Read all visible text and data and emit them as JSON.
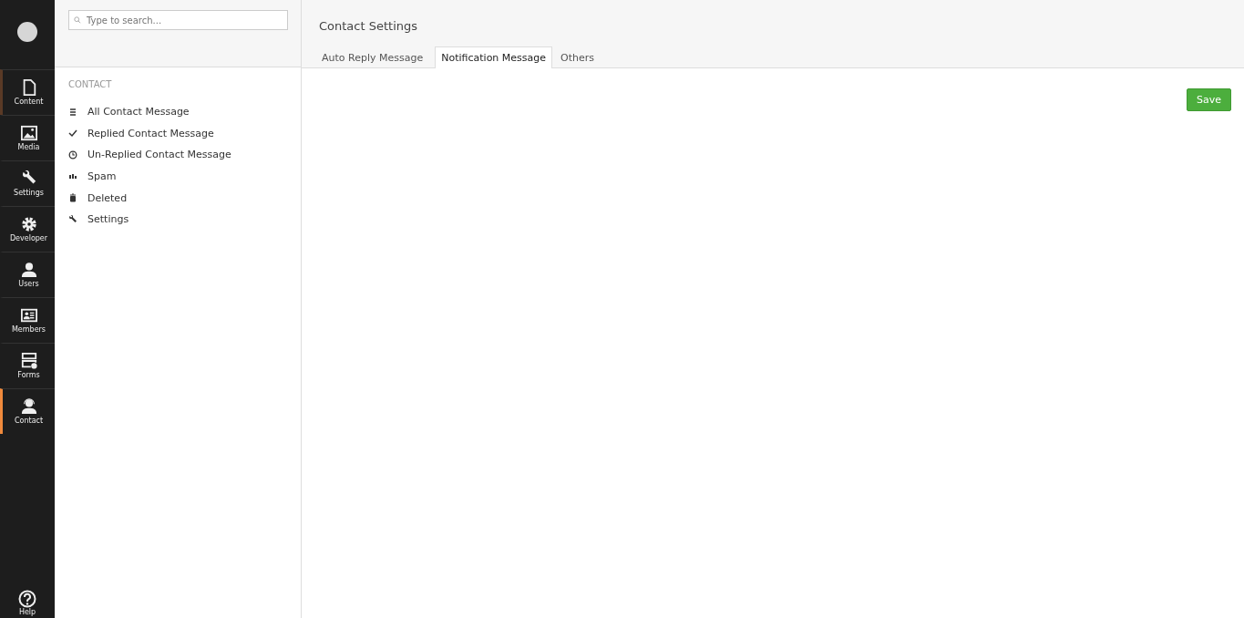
{
  "sections": [
    {
      "label": "Content",
      "selected": false,
      "hovered": true
    },
    {
      "label": "Media",
      "selected": false,
      "hovered": false
    },
    {
      "label": "Settings",
      "selected": false,
      "hovered": false
    },
    {
      "label": "Developer",
      "selected": false,
      "hovered": false
    },
    {
      "label": "Users",
      "selected": false,
      "hovered": false
    },
    {
      "label": "Members",
      "selected": false,
      "hovered": false
    },
    {
      "label": "Forms",
      "selected": false,
      "hovered": false
    },
    {
      "label": "Contact",
      "selected": true,
      "hovered": false
    }
  ],
  "help": {
    "label": "Help"
  },
  "search": {
    "placeholder": "Type to search..."
  },
  "tree": {
    "heading": "CONTACT",
    "items": [
      {
        "label": "All Contact Message"
      },
      {
        "label": "Replied Contact Message"
      },
      {
        "label": "Un-Replied Contact Message"
      },
      {
        "label": "Spam"
      },
      {
        "label": "Deleted"
      },
      {
        "label": "Settings"
      }
    ]
  },
  "editor": {
    "title": "Contact Settings",
    "tabs": [
      {
        "label": "Auto Reply Message",
        "selected": false
      },
      {
        "label": "Notification Message",
        "selected": true
      },
      {
        "label": "Others",
        "selected": false
      }
    ],
    "save_button": "Save"
  }
}
